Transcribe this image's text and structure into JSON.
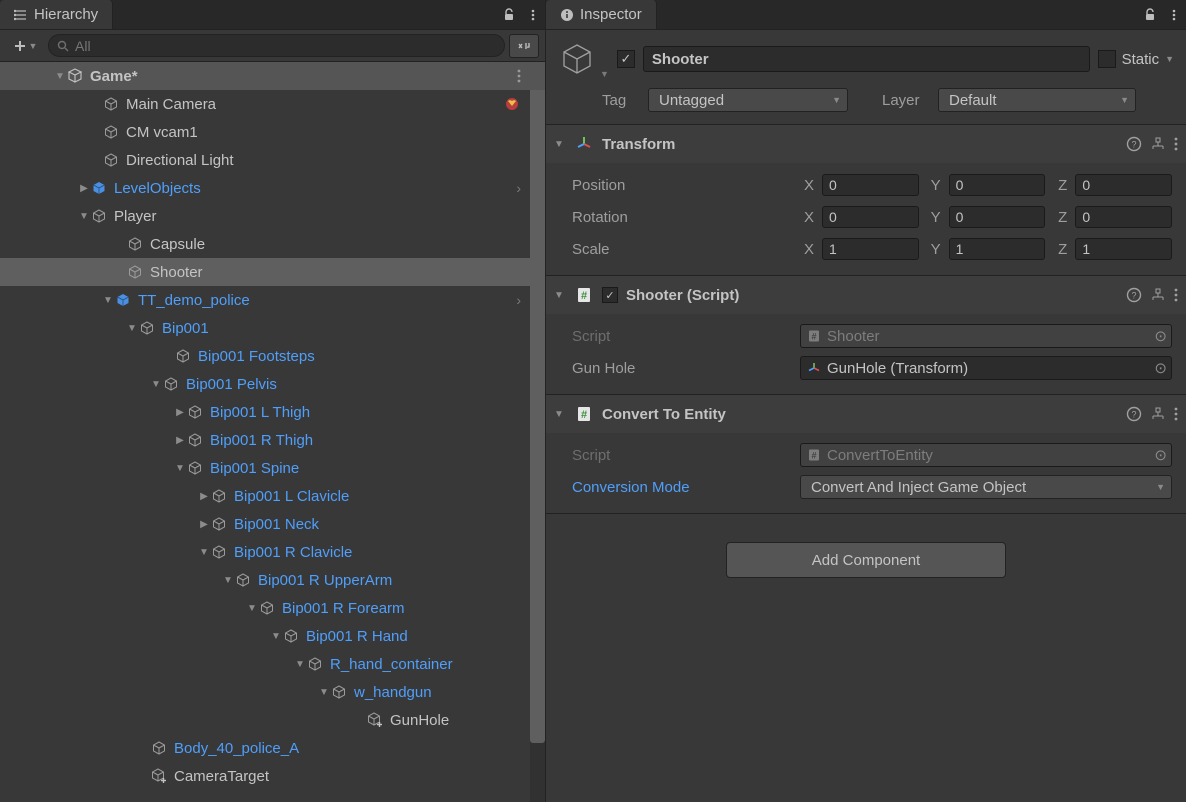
{
  "hierarchy": {
    "tab": "Hierarchy",
    "search_placeholder": "All",
    "scene": "Game*",
    "items": {
      "main_camera": "Main Camera",
      "cm_vcam1": "CM vcam1",
      "directional_light": "Directional Light",
      "level_objects": "LevelObjects",
      "player": "Player",
      "capsule": "Capsule",
      "shooter": "Shooter",
      "tt_demo_police": "TT_demo_police",
      "bip001": "Bip001",
      "bip001_footsteps": "Bip001 Footsteps",
      "bip001_pelvis": "Bip001 Pelvis",
      "bip001_l_thigh": "Bip001 L Thigh",
      "bip001_r_thigh": "Bip001 R Thigh",
      "bip001_spine": "Bip001 Spine",
      "bip001_l_clavicle": "Bip001 L Clavicle",
      "bip001_neck": "Bip001 Neck",
      "bip001_r_clavicle": "Bip001 R Clavicle",
      "bip001_r_upperarm": "Bip001 R UpperArm",
      "bip001_r_forearm": "Bip001 R Forearm",
      "bip001_r_hand": "Bip001 R Hand",
      "r_hand_container": "R_hand_container",
      "w_handgun": "w_handgun",
      "gunhole": "GunHole",
      "body_40_police_a": "Body_40_police_A",
      "camera_target": "CameraTarget"
    }
  },
  "inspector": {
    "tab": "Inspector",
    "go_name": "Shooter",
    "static_label": "Static",
    "tag_label": "Tag",
    "tag_value": "Untagged",
    "layer_label": "Layer",
    "layer_value": "Default",
    "transform": {
      "title": "Transform",
      "position_label": "Position",
      "rotation_label": "Rotation",
      "scale_label": "Scale",
      "x": "X",
      "y": "Y",
      "z": "Z",
      "pos": {
        "x": "0",
        "y": "0",
        "z": "0"
      },
      "rot": {
        "x": "0",
        "y": "0",
        "z": "0"
      },
      "scl": {
        "x": "1",
        "y": "1",
        "z": "1"
      }
    },
    "shooter_script": {
      "title": "Shooter (Script)",
      "script_label": "Script",
      "script_value": "Shooter",
      "gunhole_label": "Gun Hole",
      "gunhole_value": "GunHole (Transform)"
    },
    "convert": {
      "title": "Convert To Entity",
      "script_label": "Script",
      "script_value": "ConvertToEntity",
      "mode_label": "Conversion Mode",
      "mode_value": "Convert And Inject Game Object"
    },
    "add_component": "Add Component"
  }
}
